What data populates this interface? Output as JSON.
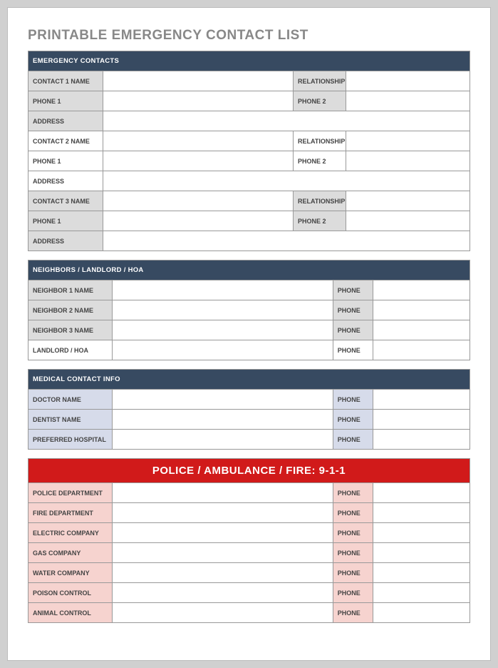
{
  "title": "PRINTABLE EMERGENCY CONTACT LIST",
  "sections": {
    "emergency": {
      "header": "EMERGENCY CONTACTS",
      "contacts": [
        {
          "name_label": "CONTACT 1 NAME",
          "rel_label": "RELATIONSHIP",
          "phone1_label": "PHONE 1",
          "phone2_label": "PHONE 2",
          "addr_label": "ADDRESS"
        },
        {
          "name_label": "CONTACT 2 NAME",
          "rel_label": "RELATIONSHIP",
          "phone1_label": "PHONE 1",
          "phone2_label": "PHONE 2",
          "addr_label": "ADDRESS"
        },
        {
          "name_label": "CONTACT 3 NAME",
          "rel_label": "RELATIONSHIP",
          "phone1_label": "PHONE 1",
          "phone2_label": "PHONE 2",
          "addr_label": "ADDRESS"
        }
      ]
    },
    "neighbors": {
      "header": "NEIGHBORS / LANDLORD / HOA",
      "rows": [
        {
          "label": "NEIGHBOR 1 NAME",
          "phone_label": "PHONE"
        },
        {
          "label": "NEIGHBOR 2 NAME",
          "phone_label": "PHONE"
        },
        {
          "label": "NEIGHBOR 3 NAME",
          "phone_label": "PHONE"
        },
        {
          "label": "LANDLORD / HOA",
          "phone_label": "PHONE"
        }
      ]
    },
    "medical": {
      "header": "MEDICAL CONTACT INFO",
      "rows": [
        {
          "label": "DOCTOR NAME",
          "phone_label": "PHONE"
        },
        {
          "label": "DENTIST NAME",
          "phone_label": "PHONE"
        },
        {
          "label": "PREFERRED HOSPITAL",
          "phone_label": "PHONE"
        }
      ]
    },
    "services": {
      "header": "POLICE / AMBULANCE / FIRE:  9-1-1",
      "rows": [
        {
          "label": "POLICE DEPARTMENT",
          "phone_label": "PHONE"
        },
        {
          "label": "FIRE DEPARTMENT",
          "phone_label": "PHONE"
        },
        {
          "label": "ELECTRIC COMPANY",
          "phone_label": "PHONE"
        },
        {
          "label": "GAS COMPANY",
          "phone_label": "PHONE"
        },
        {
          "label": "WATER COMPANY",
          "phone_label": "PHONE"
        },
        {
          "label": "POISON CONTROL",
          "phone_label": "PHONE"
        },
        {
          "label": "ANIMAL CONTROL",
          "phone_label": "PHONE"
        }
      ]
    }
  }
}
